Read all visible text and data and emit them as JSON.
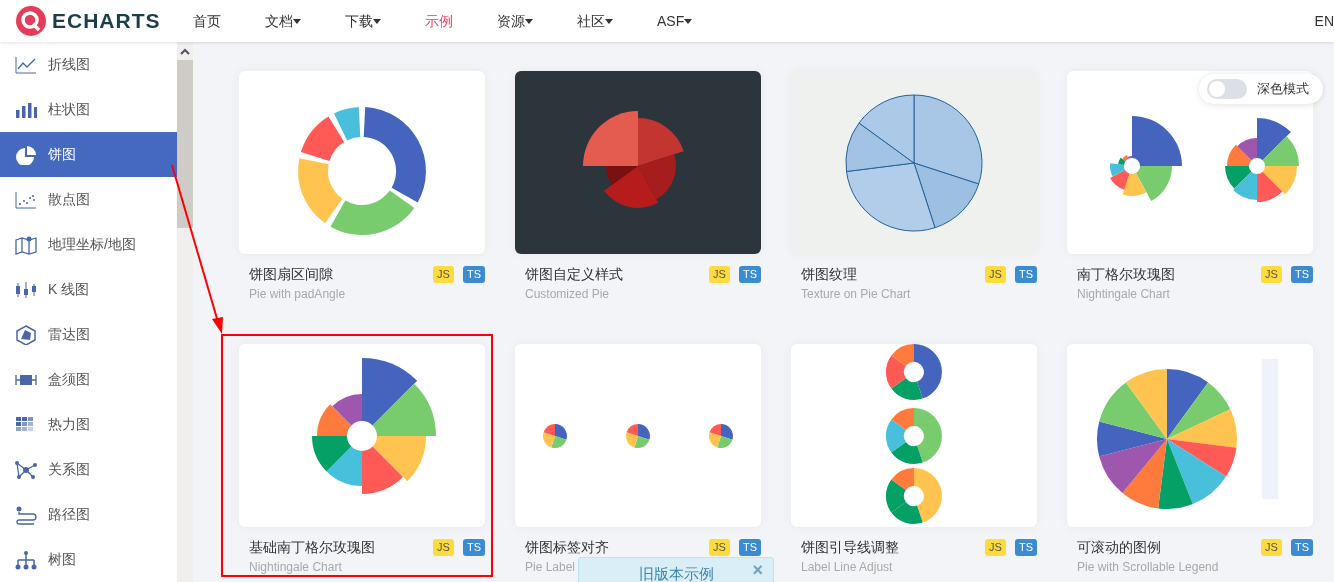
{
  "logo": {
    "text": "ECHARTS"
  },
  "nav": [
    {
      "label": "首页",
      "dropdown": false,
      "selected": false
    },
    {
      "label": "文档",
      "dropdown": true,
      "selected": false
    },
    {
      "label": "下载",
      "dropdown": true,
      "selected": false
    },
    {
      "label": "示例",
      "dropdown": false,
      "selected": true
    },
    {
      "label": "资源",
      "dropdown": true,
      "selected": false
    },
    {
      "label": "社区",
      "dropdown": true,
      "selected": false
    },
    {
      "label": "ASF",
      "dropdown": true,
      "selected": false
    }
  ],
  "language": "EN",
  "sidebar": {
    "items": [
      {
        "label": "折线图",
        "kind": "line",
        "selected": false
      },
      {
        "label": "柱状图",
        "kind": "bar",
        "selected": false
      },
      {
        "label": "饼图",
        "kind": "pie",
        "selected": true
      },
      {
        "label": "散点图",
        "kind": "scatter",
        "selected": false
      },
      {
        "label": "地理坐标/地图",
        "kind": "map",
        "selected": false
      },
      {
        "label": "K 线图",
        "kind": "candlestick",
        "selected": false
      },
      {
        "label": "雷达图",
        "kind": "radar",
        "selected": false
      },
      {
        "label": "盒须图",
        "kind": "boxplot",
        "selected": false
      },
      {
        "label": "热力图",
        "kind": "heatmap",
        "selected": false
      },
      {
        "label": "关系图",
        "kind": "graph",
        "selected": false
      },
      {
        "label": "路径图",
        "kind": "lines",
        "selected": false
      },
      {
        "label": "树图",
        "kind": "tree",
        "selected": false
      }
    ]
  },
  "dark_mode": {
    "label": "深色模式",
    "on": false
  },
  "cards": [
    {
      "title": "饼图扇区间隙",
      "subtitle": "Pie with padAngle",
      "badges": [
        "JS",
        "TS"
      ],
      "highlighted": false
    },
    {
      "title": "饼图自定义样式",
      "subtitle": "Customized Pie",
      "badges": [
        "JS",
        "TS"
      ],
      "highlighted": false
    },
    {
      "title": "饼图纹理",
      "subtitle": "Texture on Pie Chart",
      "badges": [
        "JS",
        "TS"
      ],
      "highlighted": false
    },
    {
      "title": "南丁格尔玫瑰图",
      "subtitle": "Nightingale Chart",
      "badges": [
        "JS",
        "TS"
      ],
      "highlighted": false
    },
    {
      "title": "基础南丁格尔玫瑰图",
      "subtitle": "Nightingale Chart",
      "badges": [
        "JS",
        "TS"
      ],
      "highlighted": true
    },
    {
      "title": "饼图标签对齐",
      "subtitle": "Pie Label",
      "badges": [
        "JS",
        "TS"
      ],
      "highlighted": false
    },
    {
      "title": "饼图引导线调整",
      "subtitle": "Label Line Adjust",
      "badges": [
        "JS",
        "TS"
      ],
      "highlighted": false
    },
    {
      "title": "可滚动的图例",
      "subtitle": "Pie with Scrollable Legend",
      "badges": [
        "JS",
        "TS"
      ],
      "highlighted": false
    }
  ],
  "legacy_banner": {
    "text": "旧版本示例",
    "close": "×"
  }
}
